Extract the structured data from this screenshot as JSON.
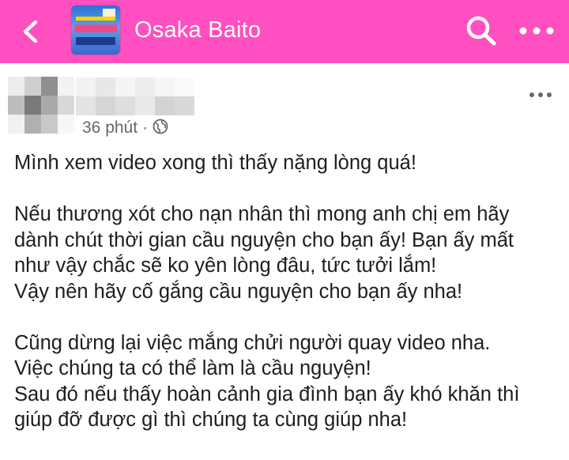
{
  "header": {
    "title": "Osaka Baito",
    "background_color": "#ff4fc0",
    "back_icon": "chevron-left-icon",
    "search_icon": "search-icon",
    "more_icon": "more-horizontal-icon"
  },
  "post": {
    "time": "36 phút",
    "separator": "·",
    "privacy_icon": "globe-icon",
    "more_icon": "more-horizontal-icon",
    "lines": [
      "Mình xem video xong thì thấy nặng lòng quá!",
      "",
      "Nếu thương xót cho nạn nhân thì  mong anh chị em hãy",
      "dành chút thời gian  cầu nguyện cho bạn ấy! Bạn ấy mất",
      "như vậy chắc sẽ ko yên lòng đâu, tức tưởi lắm!",
      "Vậy nên hãy cố gắng cầu nguyện cho bạn ấy nha!",
      "",
      "Cũng dừng lại việc mắng chửi người quay video nha.",
      "Việc chúng ta có thể làm là cầu nguyện!",
      "Sau đó nếu thấy hoàn cảnh gia đình bạn ấy khó khăn thì",
      "giúp đỡ được gì thì chúng ta cùng giúp nha!"
    ]
  }
}
